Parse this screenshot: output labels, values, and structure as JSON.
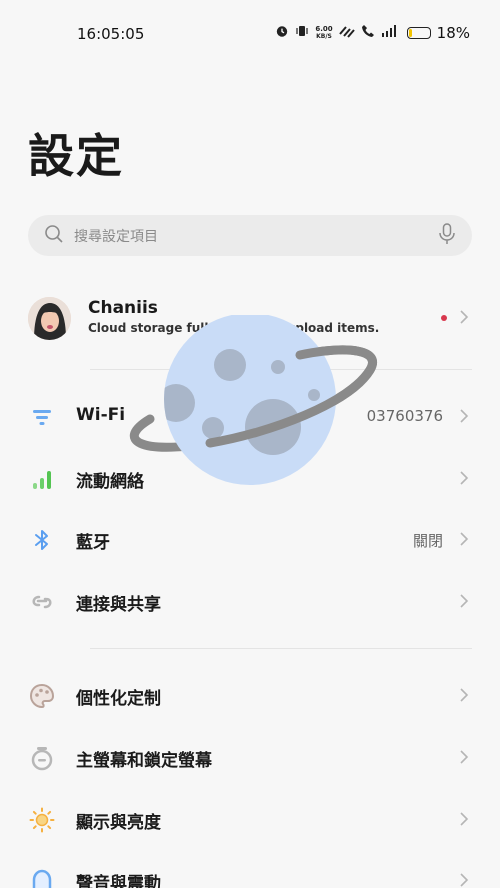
{
  "status_bar": {
    "time": "16:05:05",
    "net_speed_value": "6.00",
    "net_speed_unit": "KB/S",
    "battery_percent": "18%",
    "battery_level": 0.18,
    "icons": [
      "alarm-icon",
      "vibrate-icon",
      "data-speed-icon",
      "wifi-call-icon",
      "call-icon",
      "signal-icon",
      "battery-icon"
    ]
  },
  "page": {
    "title": "設定"
  },
  "search": {
    "placeholder": "搜尋設定項目"
  },
  "profile": {
    "name": "Chaniis",
    "subtitle": "Cloud storage full. Unable to upload items."
  },
  "settings": {
    "wifi": {
      "label": "Wi-Fi",
      "value": "03760376",
      "icon": "wifi-icon"
    },
    "mobile": {
      "label": "流動網絡",
      "icon": "mobile-network-icon"
    },
    "bluetooth": {
      "label": "藍牙",
      "value": "關閉",
      "icon": "bluetooth-icon"
    },
    "sharing": {
      "label": "連接與共享",
      "icon": "link-icon"
    },
    "personalize": {
      "label": "個性化定制",
      "icon": "palette-icon"
    },
    "homescreen": {
      "label": "主螢幕和鎖定螢幕",
      "icon": "lock-screen-icon"
    },
    "display": {
      "label": "顯示與亮度",
      "icon": "brightness-icon"
    },
    "sound": {
      "label": "聲音與震動",
      "icon": "bell-icon"
    }
  },
  "colors": {
    "accent_blue": "#6aa9f0",
    "accent_green": "#6ccf6a",
    "accent_orange": "#f5b040",
    "notification_red": "#d8374d"
  }
}
